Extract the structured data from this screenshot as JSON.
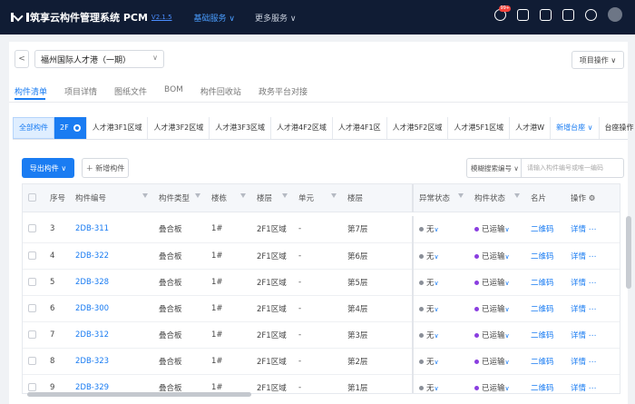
{
  "header": {
    "app_title": "筑享云构件管理系统 PCM",
    "version": "V2.1.5",
    "nav": [
      "基础服务 ∨",
      "更多服务 ∨"
    ],
    "notif_badge": "99+"
  },
  "project": {
    "selected": "福州国际人才港（一期）",
    "ops_label": "项目操作 ∨"
  },
  "tabs": [
    "构件清单",
    "项目详情",
    "图纸文件",
    "BOM",
    "构件回收站",
    "政务平台对接"
  ],
  "area_tabs": {
    "all": "全部构件",
    "selected": "2F",
    "items": [
      "人才港3F1区域",
      "人才港3F2区域",
      "人才港3F3区域",
      "人才港4F2区域",
      "人才港4F1区",
      "人才港5F2区域",
      "人才港5F1区域",
      "人才港W"
    ],
    "add": "新增台座 ∨",
    "pedestal_ops": "台座操作 ∨"
  },
  "toolbar": {
    "export": "导出构件 ∨",
    "add": "＋ 新增构件",
    "search_type": "模糊搜索编号 ∨",
    "search_placeholder": "请输入构件编号或唯一编码"
  },
  "columns": [
    "序号",
    "构件编号",
    "构件类型",
    "楼栋",
    "楼层",
    "单元",
    "楼层",
    "异常状态",
    "构件状态",
    "名片",
    "操作"
  ],
  "colors": {
    "accent": "#1a7cf2",
    "status_shipped": "#8a3ee0",
    "status_none": "#8a8f98"
  },
  "rows": [
    {
      "no": "3",
      "code": "2DB-311",
      "type": "叠合板",
      "building": "1#",
      "floor": "2F1区域",
      "unit": "-",
      "level": "第7层",
      "abnormal": "无",
      "status": "已运输",
      "card": "二维码",
      "op": "详情"
    },
    {
      "no": "4",
      "code": "2DB-322",
      "type": "叠合板",
      "building": "1#",
      "floor": "2F1区域",
      "unit": "-",
      "level": "第6层",
      "abnormal": "无",
      "status": "已运输",
      "card": "二维码",
      "op": "详情"
    },
    {
      "no": "5",
      "code": "2DB-328",
      "type": "叠合板",
      "building": "1#",
      "floor": "2F1区域",
      "unit": "-",
      "level": "第5层",
      "abnormal": "无",
      "status": "已运输",
      "card": "二维码",
      "op": "详情"
    },
    {
      "no": "6",
      "code": "2DB-300",
      "type": "叠合板",
      "building": "1#",
      "floor": "2F1区域",
      "unit": "-",
      "level": "第4层",
      "abnormal": "无",
      "status": "已运输",
      "card": "二维码",
      "op": "详情"
    },
    {
      "no": "7",
      "code": "2DB-312",
      "type": "叠合板",
      "building": "1#",
      "floor": "2F1区域",
      "unit": "-",
      "level": "第3层",
      "abnormal": "无",
      "status": "已运输",
      "card": "二维码",
      "op": "详情"
    },
    {
      "no": "8",
      "code": "2DB-323",
      "type": "叠合板",
      "building": "1#",
      "floor": "2F1区域",
      "unit": "-",
      "level": "第2层",
      "abnormal": "无",
      "status": "已运输",
      "card": "二维码",
      "op": "详情"
    },
    {
      "no": "9",
      "code": "2DB-329",
      "type": "叠合板",
      "building": "1#",
      "floor": "2F1区域",
      "unit": "-",
      "level": "第1层",
      "abnormal": "无",
      "status": "已运输",
      "card": "二维码",
      "op": "详情"
    }
  ]
}
